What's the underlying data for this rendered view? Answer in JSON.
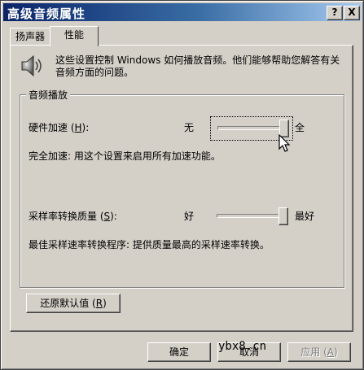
{
  "window": {
    "title": "高级音频属性",
    "help_button": "?",
    "close_button": "X"
  },
  "tabs": [
    {
      "label": "扬声器",
      "active": false
    },
    {
      "label": "性能",
      "active": true
    }
  ],
  "intro": {
    "icon": "speaker-icon",
    "text": "这些设置控制 Windows 如何播放音频。他们能够帮助您解答有关音频方面的问题。"
  },
  "group": {
    "title": "音频播放",
    "hardware_accel": {
      "label_prefix": "硬件加速 (",
      "hotkey": "H",
      "label_suffix": "):",
      "min_label": "无",
      "max_label": "全",
      "value_fraction": 1.0,
      "description": "完全加速: 用这个设置来启用所有加速功能。"
    },
    "sample_rate": {
      "label_prefix": "采样率转换质量 (",
      "hotkey": "S",
      "label_suffix": "):",
      "min_label": "好",
      "max_label": "最好",
      "value_fraction": 1.0,
      "description": "最佳采样速率转换程序: 提供质量最高的采样速率转换。"
    }
  },
  "restore_button": {
    "label_prefix": "还原默认值 (",
    "hotkey": "R",
    "label_suffix": ")"
  },
  "footer": {
    "ok": "确定",
    "cancel": "取消",
    "apply_prefix": "应用 (",
    "apply_hotkey": "A",
    "apply_suffix": ")"
  },
  "watermark": "ybx8.cn"
}
